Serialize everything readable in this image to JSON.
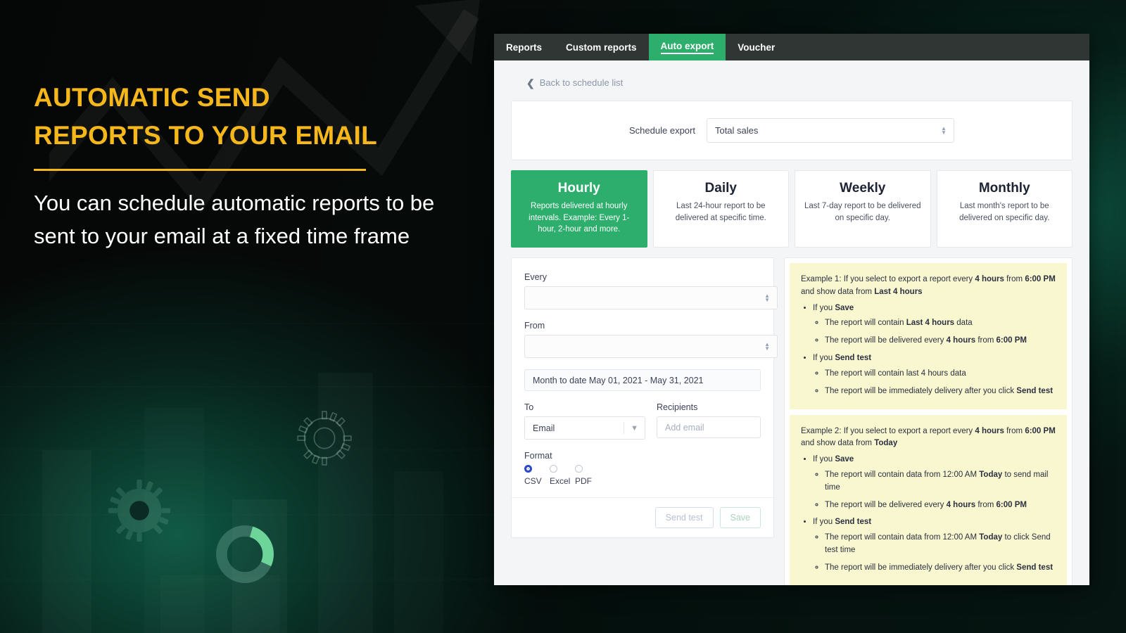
{
  "promo": {
    "headline_line1": "AUTOMATIC SEND",
    "headline_line2": "REPORTS TO YOUR EMAIL",
    "subcopy": "You can schedule automatic reports to be sent to your email at a fixed time frame",
    "accent_color": "#F5B719",
    "text_color": "#FFFFFF",
    "background_color": "#050807"
  },
  "app": {
    "tabs": [
      {
        "label": "Reports",
        "active": false
      },
      {
        "label": "Custom reports",
        "active": false
      },
      {
        "label": "Auto export",
        "active": true
      },
      {
        "label": "Voucher",
        "active": false
      }
    ],
    "active_tab_color": "#2EAE6D",
    "tabbar_color": "#303634",
    "back_link": "Back to schedule list",
    "schedule_export": {
      "label": "Schedule export",
      "value": "Total sales"
    },
    "frequency_cards": [
      {
        "title": "Hourly",
        "desc": "Reports delivered at hourly intervals. Example: Every 1-hour, 2-hour and more.",
        "active": true
      },
      {
        "title": "Daily",
        "desc": "Last 24-hour report to be delivered at specific time.",
        "active": false
      },
      {
        "title": "Weekly",
        "desc": "Last 7-day report to be delivered on specific day.",
        "active": false
      },
      {
        "title": "Monthly",
        "desc": "Last month's report to be delivered on specific day.",
        "active": false
      }
    ],
    "form": {
      "every_label": "Every",
      "every_value": "",
      "from_label": "From",
      "from_value": "",
      "date_range": "Month to date May 01, 2021 - May 31, 2021",
      "to_label": "To",
      "to_value": "Email",
      "recipients_label": "Recipients",
      "recipients_placeholder": "Add email",
      "format_label": "Format",
      "format_options": [
        {
          "label": "CSV",
          "selected": true
        },
        {
          "label": "Excel",
          "selected": false
        },
        {
          "label": "PDF",
          "selected": false
        }
      ],
      "send_test_label": "Send test",
      "save_label": "Save"
    },
    "examples": {
      "example1": {
        "intro_a": "Example 1: If you select to export a report every ",
        "intro_b": "4 hours",
        "intro_c": " from ",
        "intro_d": "6:00 PM",
        "intro_e": " and show data from ",
        "intro_f": "Last 4 hours",
        "save_head_a": "If you ",
        "save_head_b": "Save",
        "save_items": [
          {
            "a": "The report will contain ",
            "b": "Last 4 hours",
            "c": " data"
          },
          {
            "a": "The report will be delivered every ",
            "b": "4 hours",
            "c": " from ",
            "d": "6:00 PM"
          }
        ],
        "test_head_a": "If you ",
        "test_head_b": "Send test",
        "test_items": [
          {
            "a": "The report will contain last 4 hours data",
            "b": "",
            "c": ""
          },
          {
            "a": "The report will be immediately delivery after you click ",
            "b": "Send test",
            "c": ""
          }
        ]
      },
      "example2": {
        "intro_a": "Example 2: If you select to export a report every ",
        "intro_b": "4 hours",
        "intro_c": " from ",
        "intro_d": "6:00 PM",
        "intro_e": " and show data from ",
        "intro_f": "Today",
        "save_head_a": "If you ",
        "save_head_b": "Save",
        "save_items": [
          {
            "a": "The report will contain data from 12:00 AM ",
            "b": "Today",
            "c": " to send mail time"
          },
          {
            "a": "The report will be delivered every ",
            "b": "4 hours",
            "c": " from ",
            "d": "6:00 PM"
          }
        ],
        "test_head_a": "If you ",
        "test_head_b": "Send test",
        "test_items": [
          {
            "a": "The report will contain data from 12:00 AM ",
            "b": "Today",
            "c": " to click Send test time"
          },
          {
            "a": "The report will be immediately delivery after you click ",
            "b": "Send test",
            "c": ""
          }
        ]
      }
    }
  }
}
